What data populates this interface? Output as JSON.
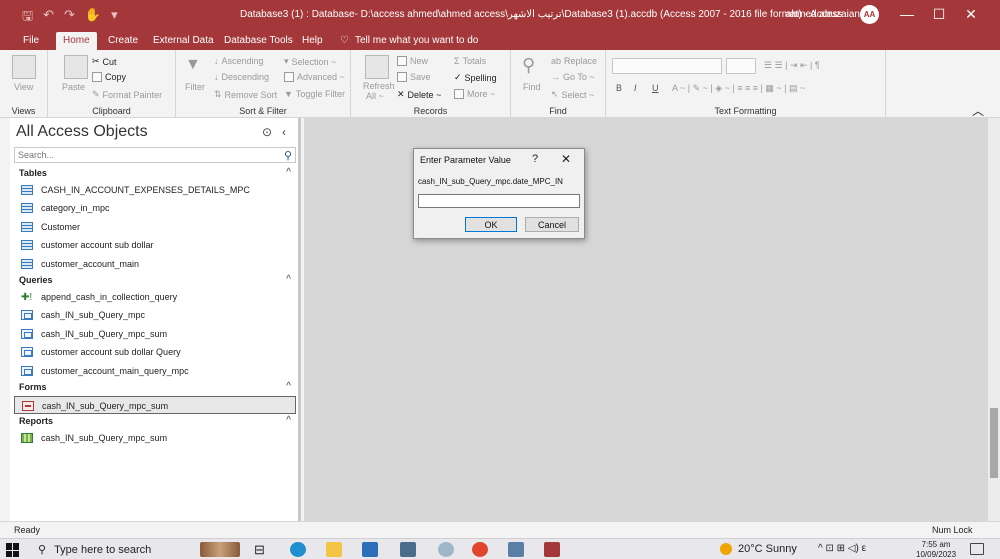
{
  "titlebar": {
    "title": "Database3 (1) : Database- D:\\access ahmed\\ahmed access\\ترتيب الاشهر\\Database3 (1).accdb (Access 2007 - 2016 file format)  -  Access",
    "user_name": "ahmed abuzaiana",
    "user_initials": "AA",
    "qat_save": "🖫",
    "qat_undo": "↶",
    "qat_redo": "↷",
    "qat_touch": "✋",
    "qat_more": "▾",
    "minimize": "—",
    "maximize": "☐",
    "close": "✕"
  },
  "tabs": [
    "File",
    "Home",
    "Create",
    "External Data",
    "Database Tools",
    "Help"
  ],
  "active_tab": "Home",
  "tell_me": "Tell me what you want to do",
  "ribbon": {
    "views": {
      "view_label": "View",
      "group": "Views"
    },
    "clipboard": {
      "paste": "Paste",
      "cut": "Cut",
      "copy": "Copy",
      "format_painter": "Format Painter",
      "group": "Clipboard"
    },
    "sort_filter": {
      "filter": "Filter",
      "ascending": "Ascending",
      "descending": "Descending",
      "remove_sort": "Remove Sort",
      "selection": "Selection ~",
      "advanced": "Advanced ~",
      "toggle_filter": "Toggle Filter",
      "group": "Sort & Filter"
    },
    "records": {
      "refresh": "Refresh",
      "refresh_sub": "All ~",
      "new": "New",
      "save": "Save",
      "delete": "Delete ~",
      "totals": "Totals",
      "spelling": "Spelling",
      "more": "More ~",
      "group": "Records"
    },
    "find": {
      "find": "Find",
      "replace": "Replace",
      "goto": "Go To ~",
      "select": "Select ~",
      "group": "Find"
    },
    "text_formatting": {
      "group": "Text Formatting",
      "bold": "B",
      "italic": "I",
      "underline": "U"
    }
  },
  "nav": {
    "title": "All Access Objects",
    "search_placeholder": "Search...",
    "sections": [
      {
        "name": "Tables",
        "items": [
          "CASH_IN_ACCOUNT_EXPENSES_DETAILS_MPC",
          "category_in_mpc",
          "Customer",
          "customer account sub dollar",
          "customer_account_main"
        ]
      },
      {
        "name": "Queries",
        "items": [
          "append_cash_in_collection_query",
          "cash_IN_sub_Query_mpc",
          "cash_IN_sub_Query_mpc_sum",
          "customer account sub dollar Query",
          "customer_account_main_query_mpc"
        ]
      },
      {
        "name": "Forms",
        "items": [
          "cash_IN_sub_Query_mpc_sum"
        ]
      },
      {
        "name": "Reports",
        "items": [
          "cash_IN_sub_Query_mpc_sum"
        ]
      }
    ]
  },
  "dialog": {
    "title": "Enter Parameter Value",
    "help": "?",
    "close": "✕",
    "prompt": "cash_IN_sub_Query_mpc.date_MPC_IN",
    "value": "",
    "ok": "OK",
    "cancel": "Cancel"
  },
  "status": {
    "left": "Ready",
    "right": "Num Lock"
  },
  "taskbar": {
    "search_placeholder": "Type here to search",
    "weather": "20°C  Sunny",
    "time": "7:55 am",
    "date": "10/09/2023",
    "tray": "^  ⊡  ⊞  ◁)  ε"
  },
  "colors": {
    "accent": "#a4373a",
    "workspace": "#d7d7d7"
  }
}
